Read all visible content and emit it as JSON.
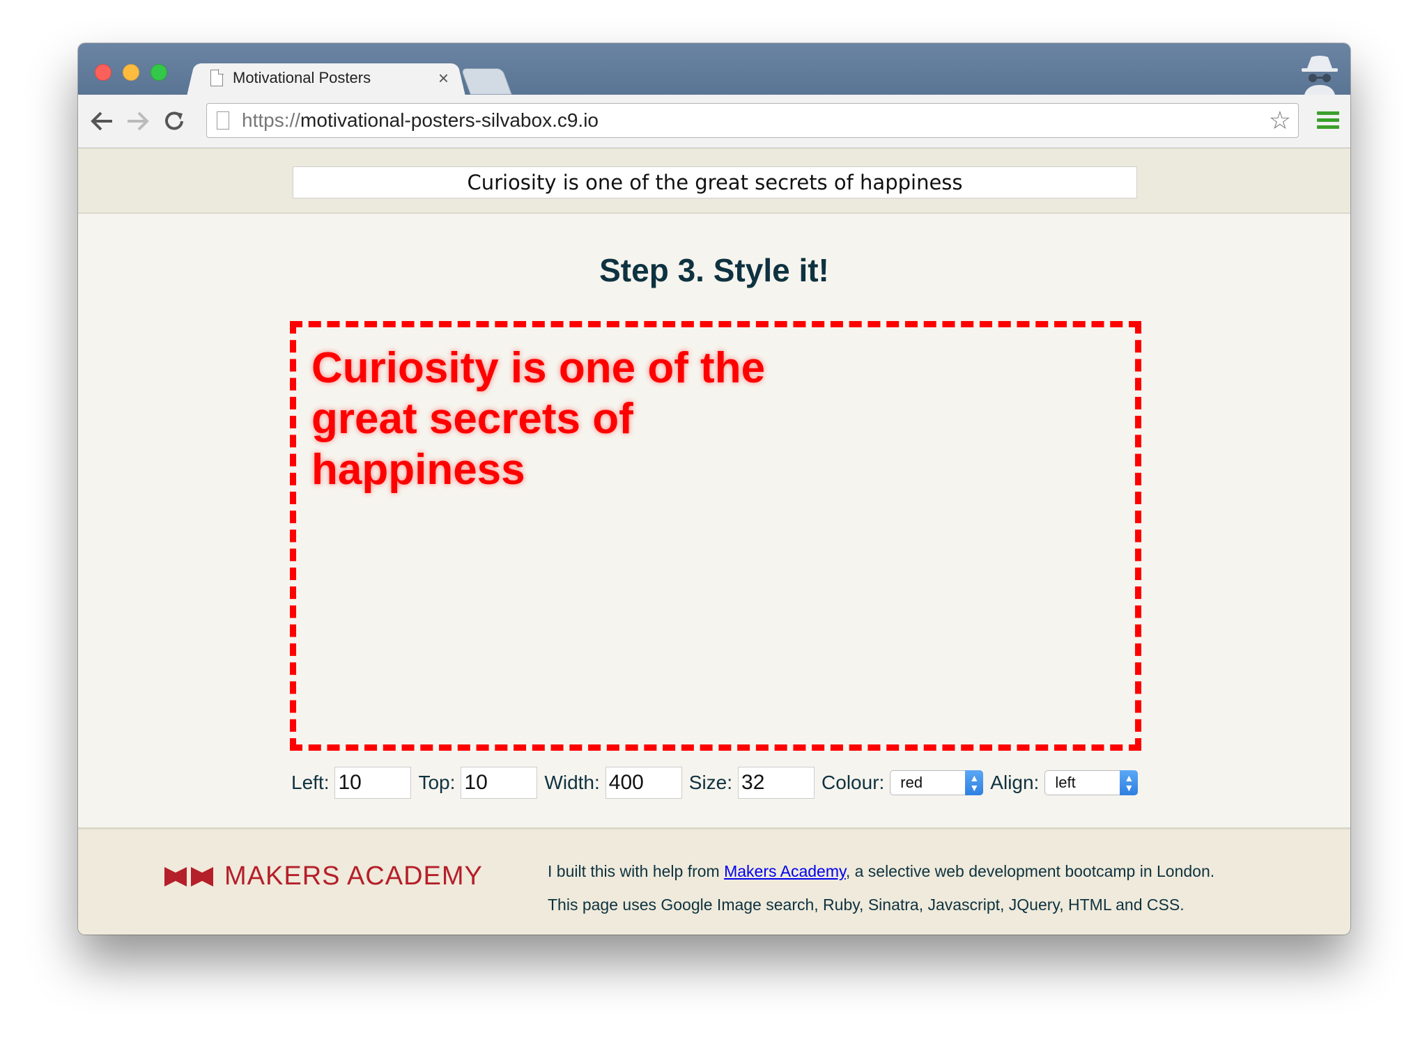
{
  "browser": {
    "tab_title": "Motivational Posters",
    "tab_close": "×",
    "url_scheme": "https://",
    "url_host": "motivational-posters-silvabox.c9.io"
  },
  "header": {
    "quote_value": "Curiosity is one of the great secrets of happiness"
  },
  "main": {
    "step_title": "Step 3. Style it!",
    "poster_text": "Curiosity is one of the great secrets of happiness",
    "poster_color": "#ff0000"
  },
  "controls": {
    "left_label": "Left:",
    "left_value": "10",
    "top_label": "Top:",
    "top_value": "10",
    "width_label": "Width:",
    "width_value": "400",
    "size_label": "Size:",
    "size_value": "32",
    "colour_label": "Colour:",
    "colour_value": "red",
    "align_label": "Align:",
    "align_value": "left"
  },
  "footer": {
    "logo_text": "MAKERS ACADEMY",
    "line1_prefix": "I built this with help from ",
    "line1_link": "Makers Academy",
    "line1_suffix": ", a selective web development bootcamp in London.",
    "line2": "This page uses Google Image search, Ruby, Sinatra, Javascript, JQuery, HTML and CSS."
  },
  "icons": {
    "back": "back-arrow-icon",
    "forward": "forward-arrow-icon",
    "reload": "reload-icon",
    "star": "bookmark-star-icon",
    "menu": "hamburger-menu-icon",
    "incognito": "incognito-icon"
  },
  "colors": {
    "brand_red": "#b51f2a",
    "heading": "#0e3240",
    "poster_border": "#ff0000"
  }
}
